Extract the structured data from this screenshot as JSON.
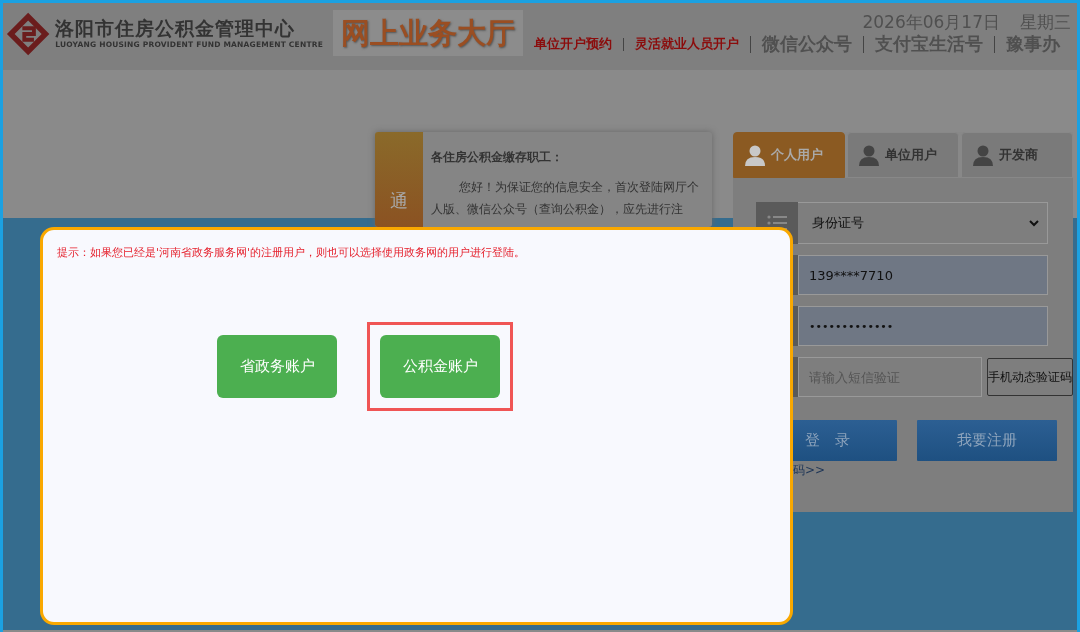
{
  "header": {
    "logo_title": "洛阳市住房公积金管理中心",
    "logo_subtitle": "LUOYANG HOUSING PROVIDENT FUND MANAGEMENT CENTRE",
    "banner": "网上业务大厅",
    "date": "2026年06月17日",
    "weekday": "星期三",
    "links": [
      {
        "label": "单位开户预约",
        "kind": "small"
      },
      {
        "label": "灵活就业人员开户",
        "kind": "small"
      },
      {
        "label": "微信公众号",
        "kind": "big"
      },
      {
        "label": "支付宝生活号",
        "kind": "big"
      },
      {
        "label": "豫事办",
        "kind": "big"
      }
    ]
  },
  "notice": {
    "tag": "通",
    "greeting": "各住房公积金缴存职工：",
    "body": "您好！为保证您的信息安全，首次登陆网厅个人版、微信公众号（查询公积金），应先进行注"
  },
  "login": {
    "tabs": [
      {
        "label": "个人用户",
        "selected": true
      },
      {
        "label": "单位用户",
        "selected": false
      },
      {
        "label": "开发商",
        "selected": false
      }
    ],
    "id_type": "身份证号",
    "account": "139****7710",
    "password": "•••••••••••••",
    "sms_placeholder": "请输入短信验证",
    "sms_button": "手机动态验证码",
    "login_button": "登　录",
    "register_button": "我要注册",
    "forgot_link": "码>>"
  },
  "dialog": {
    "hint": "提示：如果您已经是'河南省政务服务网'的注册用户，则也可以选择使用政务网的用户进行登陆。",
    "options": [
      {
        "label": "省政务账户",
        "highlighted": false
      },
      {
        "label": "公积金账户",
        "highlighted": true
      }
    ]
  }
}
